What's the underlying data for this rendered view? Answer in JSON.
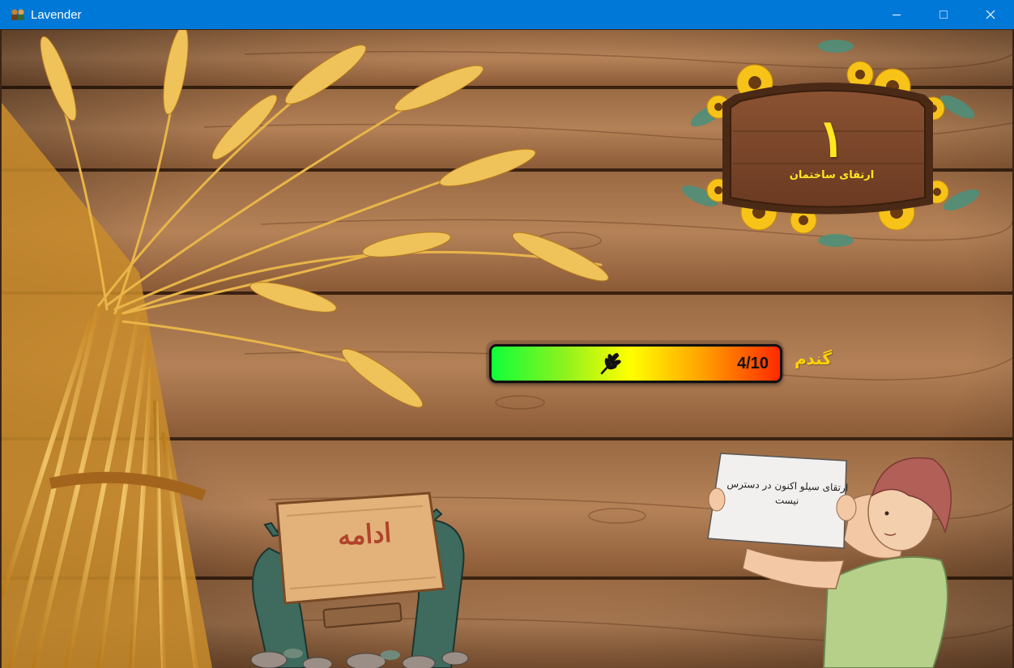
{
  "window": {
    "title": "Lavender",
    "buttons": {
      "minimize": "minimize-icon",
      "maximize": "maximize-icon",
      "close": "close-icon"
    }
  },
  "level_board": {
    "number": "۱",
    "caption": "ارتقای ساختمان"
  },
  "progress": {
    "resource": "گندم",
    "count": "4/10",
    "icon": "wheat-icon",
    "fraction": 0.4
  },
  "continue_sign": {
    "label": "ادامه"
  },
  "notice": {
    "text": "ارتقای سیلو اکنون در دسترس نیست"
  },
  "colors": {
    "titlebar": "#0078d7",
    "accent_yellow": "#ffe820",
    "wood": "#8b5a33",
    "bar_start": "#10ff3a",
    "bar_mid": "#ffff00",
    "bar_end": "#ff2a00"
  }
}
